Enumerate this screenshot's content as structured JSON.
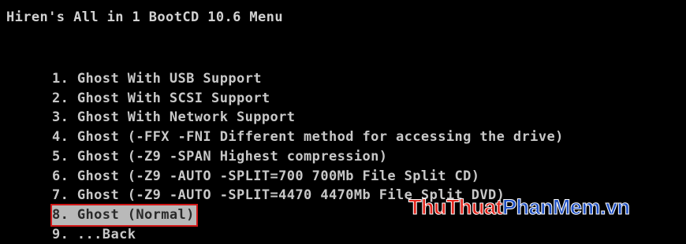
{
  "header": {
    "title": "Hiren's All in 1 BootCD 10.6 Menu"
  },
  "menu": {
    "items": [
      {
        "label": "1. Ghost With USB Support"
      },
      {
        "label": "2. Ghost With SCSI Support"
      },
      {
        "label": "3. Ghost With Network Support"
      },
      {
        "label": "4. Ghost (-FFX -FNI Different method for accessing the drive)"
      },
      {
        "label": "5. Ghost (-Z9 -SPAN Highest compression)"
      },
      {
        "label": "6. Ghost (-Z9 -AUTO -SPLIT=700 700Mb File Split CD)"
      },
      {
        "label": "7. Ghost (-Z9 -AUTO -SPLIT=4470 4470Mb File Split DVD)"
      },
      {
        "label": "8. Ghost (Normal)",
        "selected": true
      },
      {
        "label": "9. ...Back"
      }
    ]
  },
  "watermark": {
    "part1": "ThuThuat",
    "part2": "PhanMem",
    "part3": ".vn"
  },
  "colors": {
    "background": "#000000",
    "text": "#c8c8c8",
    "selected_bg": "#b9b9b9",
    "highlight_border": "#d01818"
  }
}
